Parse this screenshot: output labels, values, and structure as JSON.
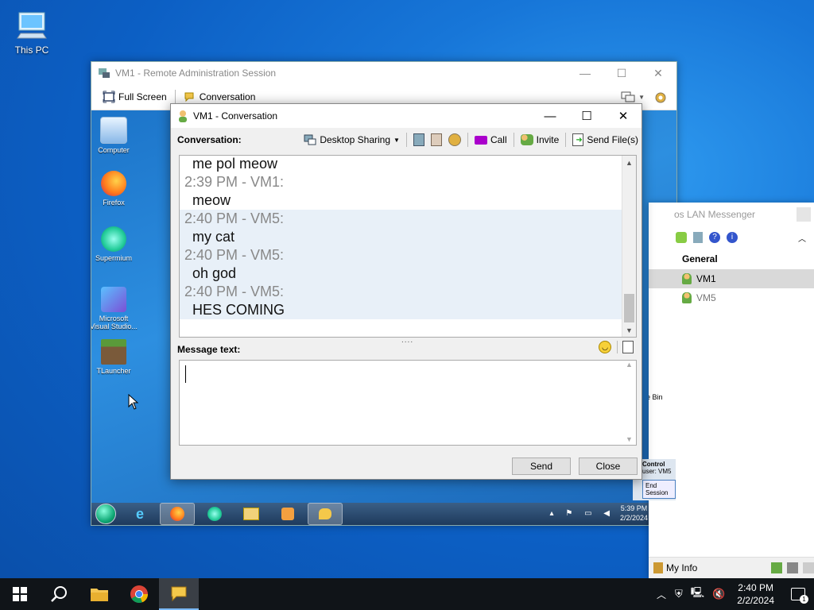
{
  "desktop": {
    "icons": [
      {
        "label": "This PC",
        "icon": "monitor-icon"
      }
    ]
  },
  "remote_session": {
    "title": "VM1 - Remote Administration Session",
    "toolbar": {
      "full_screen": "Full Screen",
      "conversation": "Conversation"
    },
    "guest_desktop": {
      "icons": [
        {
          "label": "Computer",
          "icon": "computer-icon"
        },
        {
          "label": "Firefox",
          "icon": "firefox-icon"
        },
        {
          "label": "Supermium",
          "icon": "supermium-icon"
        },
        {
          "label": "Microsoft Visual Studio...",
          "icon": "visual-studio-icon"
        },
        {
          "label": "TLauncher",
          "icon": "minecraft-icon"
        }
      ],
      "right_icon": "ycle Bin",
      "control_panel": {
        "title": "Control",
        "user": "user: VM5",
        "end_session": "End Session"
      },
      "taskbar": {
        "time": "5:39 PM",
        "date": "2/2/2024"
      }
    }
  },
  "conversation": {
    "title": "VM1 - Conversation",
    "label": "Conversation:",
    "toolbar": {
      "desktop_sharing": "Desktop Sharing",
      "call": "Call",
      "invite": "Invite",
      "send_files": "Send File(s)"
    },
    "messages": [
      {
        "text": "me pol meow",
        "kind": "text",
        "highlight": false
      },
      {
        "text": "2:39 PM - VM1:",
        "kind": "ts",
        "highlight": false
      },
      {
        "text": "meow",
        "kind": "text",
        "highlight": false
      },
      {
        "text": "2:40 PM - VM5:",
        "kind": "ts",
        "highlight": true
      },
      {
        "text": "my cat",
        "kind": "text",
        "highlight": true
      },
      {
        "text": "2:40 PM - VM5:",
        "kind": "ts",
        "highlight": true
      },
      {
        "text": "oh god",
        "kind": "text",
        "highlight": true
      },
      {
        "text": "2:40 PM - VM5:",
        "kind": "ts",
        "highlight": true
      },
      {
        "text": "HES COMING",
        "kind": "text",
        "highlight": true
      }
    ],
    "splitter": "....",
    "message_label": "Message text:",
    "message_value": "",
    "buttons": {
      "send": "Send",
      "close": "Close"
    }
  },
  "messenger": {
    "title": "os LAN Messenger",
    "group": "General",
    "users": [
      {
        "name": "VM1",
        "selected": true
      },
      {
        "name": "VM5",
        "selected": false
      }
    ],
    "my_info": "My Info"
  },
  "taskbar": {
    "time": "2:40 PM",
    "date": "2/2/2024",
    "notification_count": "1"
  },
  "colors": {
    "accent": "#0078d7",
    "highlight": "#e8f0f8",
    "taskbar": "#101418"
  }
}
